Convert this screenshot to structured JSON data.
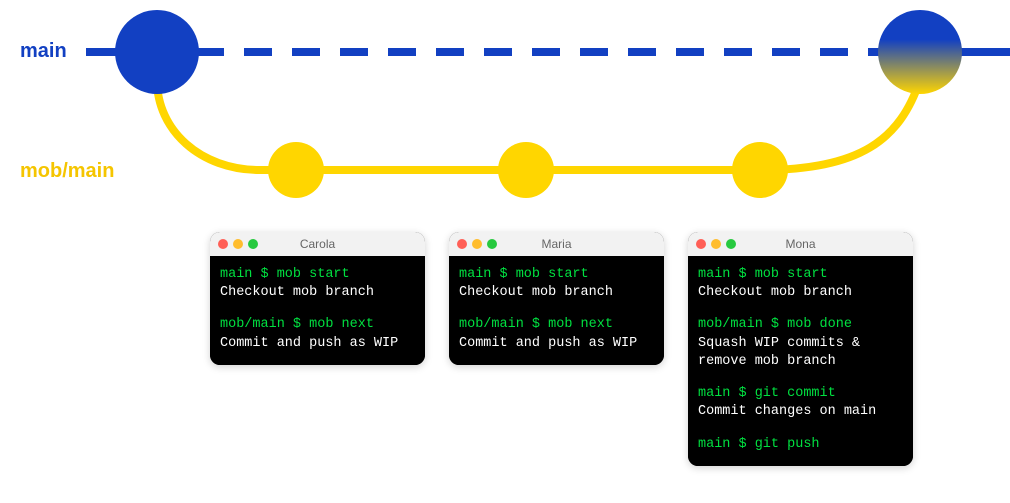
{
  "branches": {
    "main": "main",
    "mob": "mob/main"
  },
  "colors": {
    "main": "#1240c2",
    "mob": "#ffd600",
    "cmd": "#00e040"
  },
  "terminals": [
    {
      "title": "Carola",
      "lines": [
        {
          "type": "cmd",
          "text": "main $ mob start"
        },
        {
          "type": "out",
          "text": "Checkout mob branch"
        },
        {
          "type": "sp"
        },
        {
          "type": "cmd",
          "text": "mob/main $ mob next"
        },
        {
          "type": "out",
          "text": "Commit and push as WIP"
        }
      ]
    },
    {
      "title": "Maria",
      "lines": [
        {
          "type": "cmd",
          "text": "main $ mob start"
        },
        {
          "type": "out",
          "text": "Checkout mob branch"
        },
        {
          "type": "sp"
        },
        {
          "type": "cmd",
          "text": "mob/main $ mob next"
        },
        {
          "type": "out",
          "text": "Commit and push as WIP"
        }
      ]
    },
    {
      "title": "Mona",
      "wide": true,
      "lines": [
        {
          "type": "cmd",
          "text": "main $ mob start"
        },
        {
          "type": "out",
          "text": "Checkout mob branch"
        },
        {
          "type": "sp"
        },
        {
          "type": "cmd",
          "text": "mob/main $ mob done"
        },
        {
          "type": "out",
          "text": "Squash WIP commits & remove mob branch"
        },
        {
          "type": "sp"
        },
        {
          "type": "cmd",
          "text": "main $ git commit"
        },
        {
          "type": "out",
          "text": "Commit changes on main"
        },
        {
          "type": "sp"
        },
        {
          "type": "cmd",
          "text": "main $ git push"
        }
      ]
    }
  ]
}
